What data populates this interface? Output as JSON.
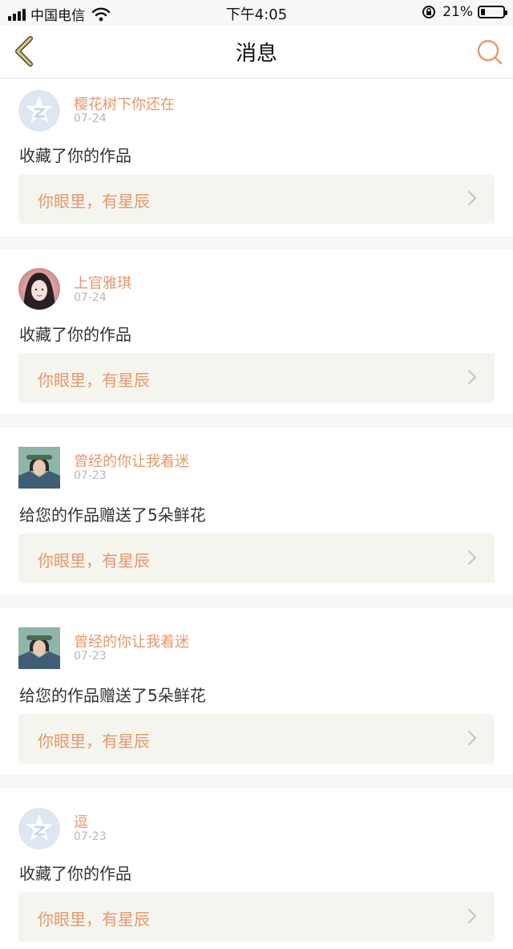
{
  "status_bar": {
    "carrier": "中国电信",
    "time": "下午4:05",
    "battery_percent": "21%",
    "battery_level": 0.21,
    "icons": [
      "signal-icon",
      "wifi-icon",
      "rotation-lock-icon",
      "battery-icon"
    ]
  },
  "nav": {
    "title": "消息",
    "back_icon": "chevron-left-icon",
    "search_icon": "search-icon",
    "accent": "#e8976a",
    "back_color": "#e6c76a"
  },
  "messages": [
    {
      "user": "樱花树下你还在",
      "date": "07-24",
      "action": "收藏了你的作品",
      "work": "你眼里，有星辰",
      "avatar": "default-avatar-icon"
    },
    {
      "user": "上官雅琪",
      "date": "07-24",
      "action": "收藏了你的作品",
      "work": "你眼里，有星辰",
      "avatar": "user-photo-avatar"
    },
    {
      "user": "曾经的你让我着迷",
      "date": "07-23",
      "action": "给您的作品赠送了5朵鲜花",
      "work": "你眼里，有星辰",
      "avatar": "user-photo-avatar"
    },
    {
      "user": "曾经的你让我着迷",
      "date": "07-23",
      "action": "给您的作品赠送了5朵鲜花",
      "work": "你眼里，有星辰",
      "avatar": "user-photo-avatar"
    },
    {
      "user": "逗",
      "date": "07-23",
      "action": "收藏了你的作品",
      "work": "你眼里，有星辰",
      "avatar": "default-avatar-icon"
    }
  ]
}
